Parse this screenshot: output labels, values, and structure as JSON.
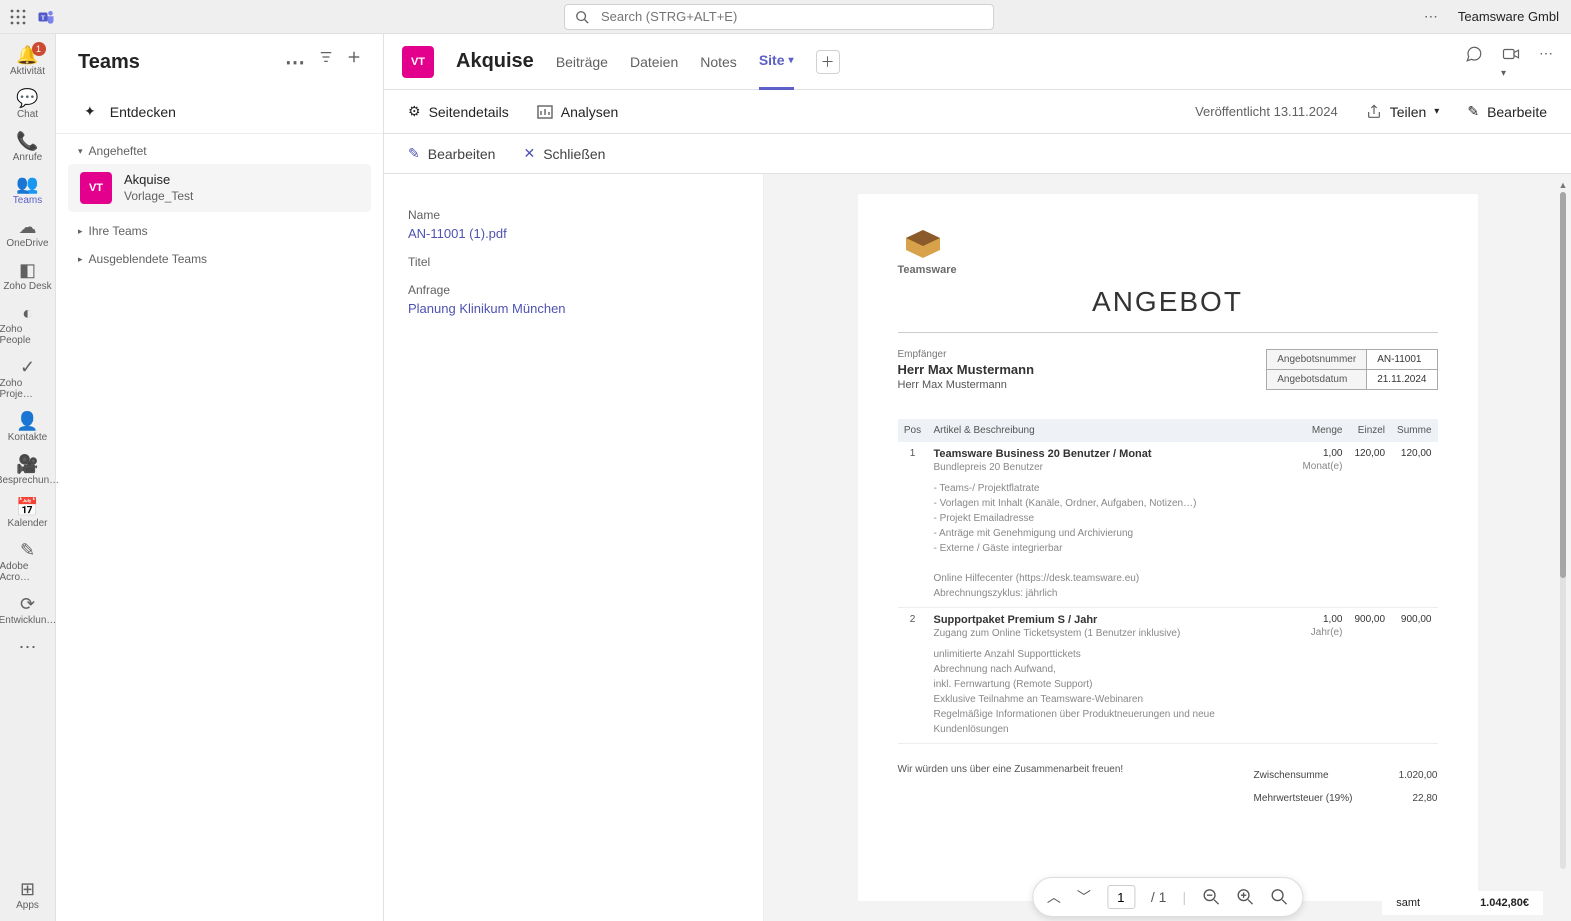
{
  "titlebar": {
    "search_placeholder": "Search (STRG+ALT+E)",
    "org": "Teamsware Gmbl"
  },
  "rail": [
    {
      "id": "activity",
      "label": "Aktivität",
      "icon": "🔔",
      "badge": "1"
    },
    {
      "id": "chat",
      "label": "Chat",
      "icon": "💬"
    },
    {
      "id": "calls",
      "label": "Anrufe",
      "icon": "📞"
    },
    {
      "id": "teams",
      "label": "Teams",
      "icon": "👥",
      "active": true
    },
    {
      "id": "onedrive",
      "label": "OneDrive",
      "icon": "☁"
    },
    {
      "id": "zohodesk",
      "label": "Zoho Desk",
      "icon": "◧"
    },
    {
      "id": "zohopeople",
      "label": "Zoho People",
      "icon": "◐"
    },
    {
      "id": "zohoproj",
      "label": "Zoho Proje…",
      "icon": "✓"
    },
    {
      "id": "kontakte",
      "label": "Kontakte",
      "icon": "👤"
    },
    {
      "id": "besprech",
      "label": "Besprechun…",
      "icon": "🎥"
    },
    {
      "id": "kalender",
      "label": "Kalender",
      "icon": "📅"
    },
    {
      "id": "acrobat",
      "label": "Adobe Acro…",
      "icon": "✎"
    },
    {
      "id": "entwick",
      "label": "Entwicklun…",
      "icon": "⟳"
    }
  ],
  "rail_more": "⋯",
  "rail_apps": {
    "label": "Apps",
    "icon": "⊞"
  },
  "teams_pane": {
    "header": "Teams",
    "discover": "Entdecken",
    "sections": {
      "pinned": "Angeheftet",
      "your": "Ihre Teams",
      "hidden": "Ausgeblendete Teams"
    },
    "pinned_channel": {
      "avatar": "VT",
      "title": "Akquise",
      "subtitle": "Vorlage_Test"
    }
  },
  "tabs": {
    "chip": "VT",
    "title": "Akquise",
    "items": [
      {
        "id": "beitraege",
        "label": "Beiträge"
      },
      {
        "id": "dateien",
        "label": "Dateien"
      },
      {
        "id": "notes",
        "label": "Notes"
      },
      {
        "id": "site",
        "label": "Site",
        "active": true,
        "dropdown": true
      }
    ]
  },
  "toolbar": {
    "details": "Seitendetails",
    "analysen": "Analysen",
    "published": "Veröffentlicht 13.11.2024",
    "teilen": "Teilen",
    "bearbeiten": "Bearbeite"
  },
  "subbar": {
    "edit": "Bearbeiten",
    "close": "Schließen"
  },
  "meta": {
    "name_k": "Name",
    "name_v": "AN-11001 (1).pdf",
    "titel_k": "Titel",
    "titel_v": "",
    "anfrage_k": "Anfrage",
    "anfrage_v": "Planung Klinikum München"
  },
  "doc": {
    "brand": "Teamsware",
    "heading": "ANGEBOT",
    "recipient_label": "Empfänger",
    "recipient_name": "Herr Max Mustermann",
    "recipient_name2": "Herr Max Mustermann",
    "offer_no_k": "Angebotsnummer",
    "offer_no_v": "AN-11001",
    "offer_date_k": "Angebotsdatum",
    "offer_date_v": "21.11.2024",
    "cols": {
      "pos": "Pos",
      "art": "Artikel & Beschreibung",
      "menge": "Menge",
      "einzel": "Einzel",
      "summe": "Summe"
    },
    "rows": [
      {
        "pos": "1",
        "art": "Teamsware Business 20 Benutzer / Monat",
        "sub": "Bundlepreis 20 Benutzer",
        "menge": "1,00",
        "unit": "Monat(e)",
        "einzel": "120,00",
        "summe": "120,00",
        "bullets": [
          "- Teams-/ Projektflatrate",
          "- Vorlagen mit Inhalt (Kanäle, Ordner, Aufgaben, Notizen…)",
          "- Projekt Emailadresse",
          "- Anträge mit Genehmigung und Archivierung",
          "- Externe / Gäste integrierbar",
          "",
          "Online Hilfecenter (https://desk.teamsware.eu)",
          "Abrechnungszyklus: jährlich"
        ]
      },
      {
        "pos": "2",
        "art": "Supportpaket Premium S / Jahr",
        "sub": "Zugang zum Online Ticketsystem (1 Benutzer inklusive)",
        "menge": "1,00",
        "unit": "Jahr(e)",
        "einzel": "900,00",
        "summe": "900,00",
        "bullets": [
          "unlimitierte Anzahl Supporttickets",
          "Abrechnung nach Aufwand,",
          "inkl. Fernwartung (Remote Support)",
          "Exklusive Teilnahme an Teamsware-Webinaren",
          "Regelmäßige Informationen über Produktneuerungen und neue Kundenlösungen"
        ]
      }
    ],
    "closing": "Wir würden uns über eine Zusammenarbeit freuen!",
    "subtotal_k": "Zwischensumme",
    "subtotal_v": "1.020,00",
    "vat_k": "Mehrwertsteuer (19%)",
    "vat_v": "22,80",
    "grand_k": "samt",
    "grand_v": "1.042,80€"
  },
  "pdfbar": {
    "page": "1",
    "pages": "1"
  }
}
